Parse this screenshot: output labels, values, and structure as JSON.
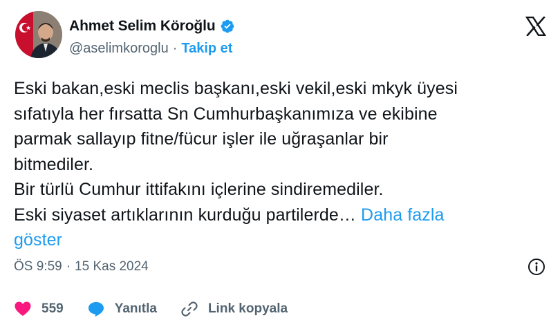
{
  "author": {
    "display_name": "Ahmet Selim Köroğlu",
    "handle": "@aselimkoroglu",
    "separator": "·",
    "follow_label": "Takip et",
    "verified_icon": "verified-badge-icon",
    "avatar": "avatar-photo"
  },
  "brand_icon": "x-logo-icon",
  "tweet": {
    "lines": [
      "Eski bakan,eski meclis başkanı,eski vekil,eski mkyk üyesi",
      "sıfatıyla her fırsatta Sn Cumhurbaşkanımıza ve ekibine",
      "parmak sallayıp fitne/fücur işler ile uğraşanlar bir",
      "bitmediler.",
      "Bir türlü Cumhur ittifakını içlerine sindiremediler.",
      "Eski siyaset artıklarının kurduğu partilerde… "
    ],
    "show_more_line1": "Daha fazla",
    "show_more_line2": "göster"
  },
  "meta": {
    "time": "ÖS 9:59",
    "separator": "·",
    "date": "15 Kas 2024",
    "info_icon": "info-icon"
  },
  "actions": {
    "like_count": "559",
    "reply_label": "Yanıtla",
    "copy_link_label": "Link kopyala"
  },
  "colors": {
    "accent": "#1d9bf0",
    "like": "#f91880",
    "text": "#0f1419",
    "muted": "#536471"
  }
}
